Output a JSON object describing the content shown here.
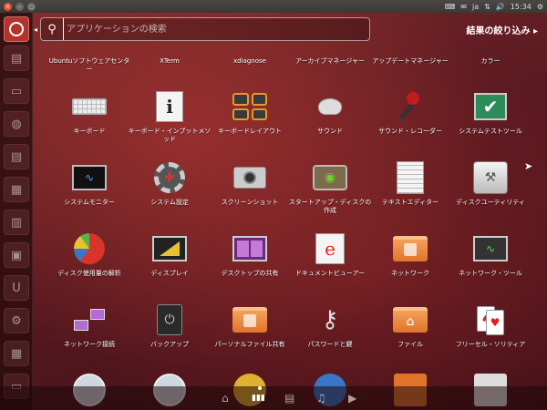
{
  "top_panel": {
    "window_buttons": {
      "close": "×",
      "minimize": "−",
      "maximize": "□"
    },
    "indicators": {
      "keyboard": "⌨",
      "mail": "✉",
      "language": "ja",
      "network": "⇅",
      "volume": "🔊",
      "time": "15:34",
      "session": "⚙"
    }
  },
  "launcher": {
    "items": [
      {
        "name": "dash-home",
        "glyph": ""
      },
      {
        "name": "files",
        "glyph": "▤"
      },
      {
        "name": "folder",
        "glyph": "▭"
      },
      {
        "name": "browser",
        "glyph": "◍"
      },
      {
        "name": "writer",
        "glyph": "▤"
      },
      {
        "name": "calc",
        "glyph": "▦"
      },
      {
        "name": "impress",
        "glyph": "▥"
      },
      {
        "name": "software-center",
        "glyph": "▣"
      },
      {
        "name": "ubuntu-one",
        "glyph": "U"
      },
      {
        "name": "settings",
        "glyph": "⚙"
      },
      {
        "name": "workspaces",
        "glyph": "▦"
      },
      {
        "name": "trash",
        "glyph": "▭"
      }
    ]
  },
  "search": {
    "placeholder": "アプリケーションの検索",
    "value": ""
  },
  "filter_label": "結果の絞り込み ▸",
  "apps": {
    "row0": [
      "Ubuntuソフトウェアセンター",
      "XTerm",
      "xdiagnose",
      "アーカイブマネージャー",
      "アップデートマネージャー",
      "カラー"
    ],
    "row1": [
      "キーボード",
      "キーボード・インプットメソッド",
      "キーボードレイアウト",
      "サウンド",
      "サウンド・レコーダー",
      "システムテストツール"
    ],
    "row2": [
      "システムモニター",
      "システム設定",
      "スクリーンショット",
      "スタートアップ・ディスクの作成",
      "テキストエディター",
      "ディスクユーティリティ"
    ],
    "row3": [
      "ディスク使用量の解析",
      "ディスプレイ",
      "デスクトップの共有",
      "ドキュメントビューアー",
      "ネットワーク",
      "ネットワーク・ツール"
    ],
    "row4": [
      "ネットワーク接続",
      "バックアップ",
      "パーソナルファイル共有",
      "パスワードと鍵",
      "ファイル",
      "フリーセル・ソリティア"
    ]
  },
  "lenses": {
    "home": "⌂",
    "apps": "▮▮▮",
    "files": "▤",
    "music": "♫",
    "video": "▶"
  },
  "icons": {
    "search": "⚲",
    "arrow": "◂",
    "cursor": "➤"
  }
}
